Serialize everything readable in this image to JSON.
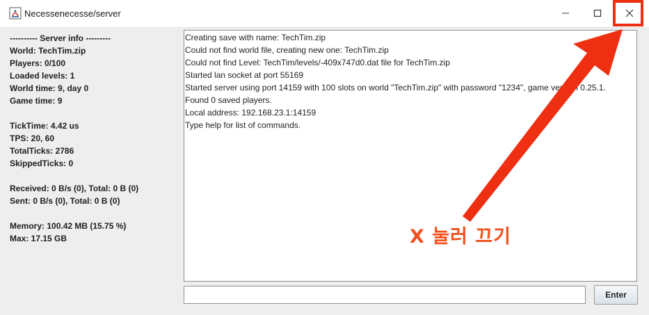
{
  "window": {
    "title": "Necessenecesse/server",
    "icon": "java-app-icon",
    "controls": [
      "minimize-icon",
      "maximize-icon",
      "close-icon"
    ]
  },
  "server_info": {
    "lines": [
      "---------- Server info ---------",
      "World: TechTim.zip",
      "Players: 0/100",
      "Loaded levels: 1",
      "World time: 9, day 0",
      "Game time: 9",
      "",
      "TickTime: 4.42 us",
      "TPS: 20, 60",
      "TotalTicks: 2786",
      "SkippedTicks: 0",
      "",
      "Received: 0 B/s (0), Total: 0 B (0)",
      "Sent: 0 B/s (0), Total: 0 B (0)",
      "",
      "Memory: 100.42 MB (15.75 %)",
      "Max: 17.15 GB"
    ]
  },
  "console": {
    "lines": [
      "Creating save with name: TechTim.zip",
      "Could not find world file, creating new one: TechTim.zip",
      "Could not find Level: TechTim/levels/-409x747d0.dat file for TechTim.zip",
      "Started lan socket at port 55169",
      "Started server using port 14159 with 100 slots on world \"TechTim.zip\" with password \"1234\", game version 0.25.1.",
      "Found 0 saved players.",
      "Local address: 192.168.23.1:14159",
      "Type help for list of commands."
    ]
  },
  "command": {
    "value": "",
    "enter_label": "Enter"
  },
  "annotation": {
    "text": "X 눌러 끄기",
    "color": "#ee2f12"
  }
}
